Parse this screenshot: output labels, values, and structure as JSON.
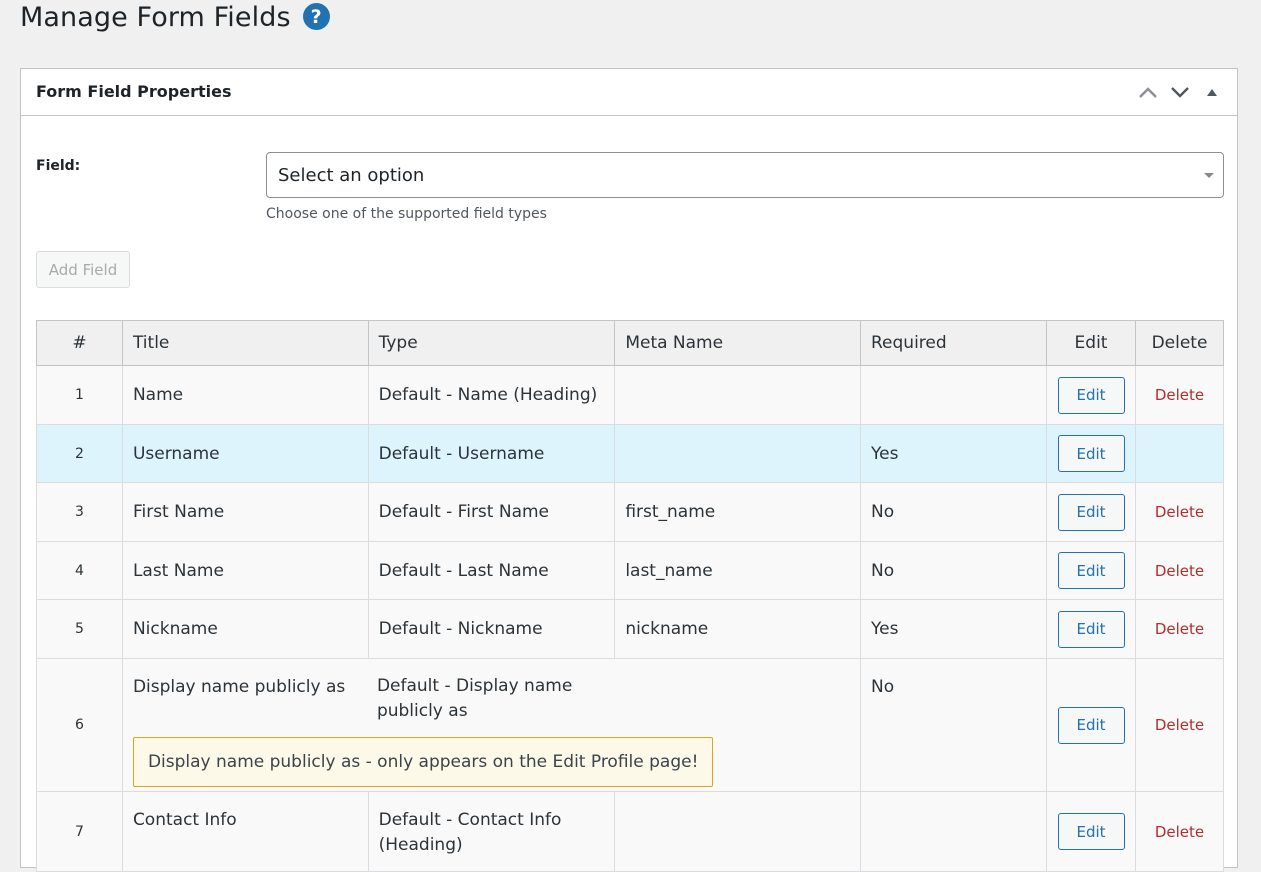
{
  "page": {
    "title": "Manage Form Fields"
  },
  "icons": {
    "help": "question-circle-icon",
    "up": "chevron-up-icon",
    "down": "chevron-down-icon",
    "toggle": "triangle-up-icon"
  },
  "colors": {
    "accent": "#2271b1",
    "delete": "#b32d2e",
    "highlight_row": "#ddf4fd",
    "notice_border": "#dba617"
  },
  "panel": {
    "title": "Form Field Properties",
    "field_label": "Field:",
    "select_value": "Select an option",
    "select_description": "Choose one of the supported field types",
    "add_button": "Add Field"
  },
  "table": {
    "headers": {
      "num": "#",
      "title": "Title",
      "type": "Type",
      "meta": "Meta Name",
      "required": "Required",
      "edit": "Edit",
      "delete": "Delete"
    },
    "rows": [
      {
        "num": "1",
        "title": "Name",
        "type": "Default - Name (Heading)",
        "meta": "",
        "required": "",
        "edit": "Edit",
        "delete": "Delete"
      },
      {
        "num": "2",
        "title": "Username",
        "type": "Default - Username",
        "meta": "",
        "required": "Yes",
        "edit": "Edit",
        "delete": ""
      },
      {
        "num": "3",
        "title": "First Name",
        "type": "Default - First Name",
        "meta": "first_name",
        "required": "No",
        "edit": "Edit",
        "delete": "Delete"
      },
      {
        "num": "4",
        "title": "Last Name",
        "type": "Default - Last Name",
        "meta": "last_name",
        "required": "No",
        "edit": "Edit",
        "delete": "Delete"
      },
      {
        "num": "5",
        "title": "Nickname",
        "type": "Default - Nickname",
        "meta": "nickname",
        "required": "Yes",
        "edit": "Edit",
        "delete": "Delete"
      },
      {
        "num": "6",
        "title": "Display name publicly as",
        "type": "Default - Display name publicly as",
        "meta": "",
        "required": "No",
        "edit": "Edit",
        "delete": "Delete",
        "notice": "Display name publicly as - only appears on the Edit Profile page!"
      },
      {
        "num": "7",
        "title": "Contact Info",
        "type": "Default - Contact Info (Heading)",
        "meta": "",
        "required": "",
        "edit": "Edit",
        "delete": "Delete"
      }
    ]
  }
}
